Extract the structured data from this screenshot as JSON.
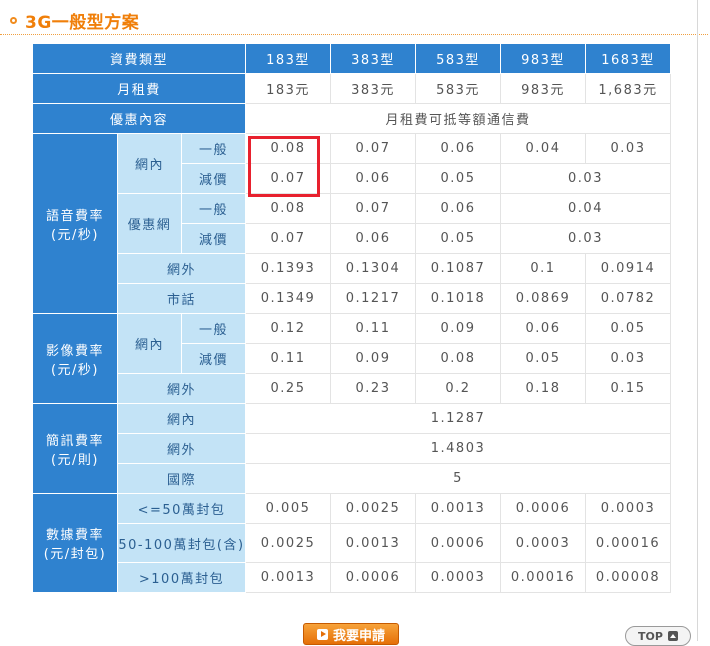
{
  "section": {
    "title": "3G一般型方案"
  },
  "table": {
    "header": {
      "label": "資費類型",
      "plans": [
        "183型",
        "383型",
        "583型",
        "983型",
        "1683型"
      ]
    },
    "monthly_fee": {
      "label": "月租費",
      "values": [
        "183元",
        "383元",
        "583元",
        "983元",
        "1,683元"
      ]
    },
    "offer": {
      "label": "優惠內容",
      "value": "月租費可抵等額通信費"
    },
    "voice": {
      "label": "語音費率(元/秒)",
      "onnet": {
        "label": "網內",
        "general": {
          "label": "一般",
          "values": [
            "0.08",
            "0.07",
            "0.06",
            "0.04",
            "0.03"
          ]
        },
        "discount": {
          "label": "減價",
          "values": [
            "0.07",
            "0.06",
            "0.05"
          ],
          "merged": "0.03"
        }
      },
      "preferred": {
        "label": "優惠網",
        "general": {
          "label": "一般",
          "values": [
            "0.08",
            "0.07",
            "0.06"
          ],
          "merged": "0.04"
        },
        "discount": {
          "label": "減價",
          "values": [
            "0.07",
            "0.06",
            "0.05"
          ],
          "merged": "0.03"
        }
      },
      "offnet": {
        "label": "網外",
        "values": [
          "0.1393",
          "0.1304",
          "0.1087",
          "0.1",
          "0.0914"
        ]
      },
      "landline": {
        "label": "市話",
        "values": [
          "0.1349",
          "0.1217",
          "0.1018",
          "0.0869",
          "0.0782"
        ]
      }
    },
    "video": {
      "label": "影像費率(元/秒)",
      "onnet": {
        "label": "網內",
        "general": {
          "label": "一般",
          "values": [
            "0.12",
            "0.11",
            "0.09",
            "0.06",
            "0.05"
          ]
        },
        "discount": {
          "label": "減價",
          "values": [
            "0.11",
            "0.09",
            "0.08",
            "0.05",
            "0.03"
          ]
        }
      },
      "offnet": {
        "label": "網外",
        "values": [
          "0.25",
          "0.23",
          "0.2",
          "0.18",
          "0.15"
        ]
      }
    },
    "sms": {
      "label": "簡訊費率(元/則)",
      "onnet": {
        "label": "網內",
        "value": "1.1287"
      },
      "offnet": {
        "label": "網外",
        "value": "1.4803"
      },
      "intl": {
        "label": "國際",
        "value": "5"
      }
    },
    "data": {
      "label": "數據費率(元/封包)",
      "tier1": {
        "label": "<=50萬封包",
        "values": [
          "0.005",
          "0.0025",
          "0.0013",
          "0.0006",
          "0.0003"
        ]
      },
      "tier2": {
        "label": "50-100萬封包(含)",
        "values": [
          "0.0025",
          "0.0013",
          "0.0006",
          "0.0003",
          "0.00016"
        ]
      },
      "tier3": {
        "label": ">100萬封包",
        "values": [
          "0.0013",
          "0.0006",
          "0.0003",
          "0.00016",
          "0.00008"
        ]
      }
    }
  },
  "buttons": {
    "apply": "我要申請",
    "top": "TOP"
  },
  "colors": {
    "header_blue": "#2f82cf",
    "sub_header": "#c3e3f6",
    "accent_orange": "#f07f0a",
    "highlight_red": "#e8212e"
  }
}
